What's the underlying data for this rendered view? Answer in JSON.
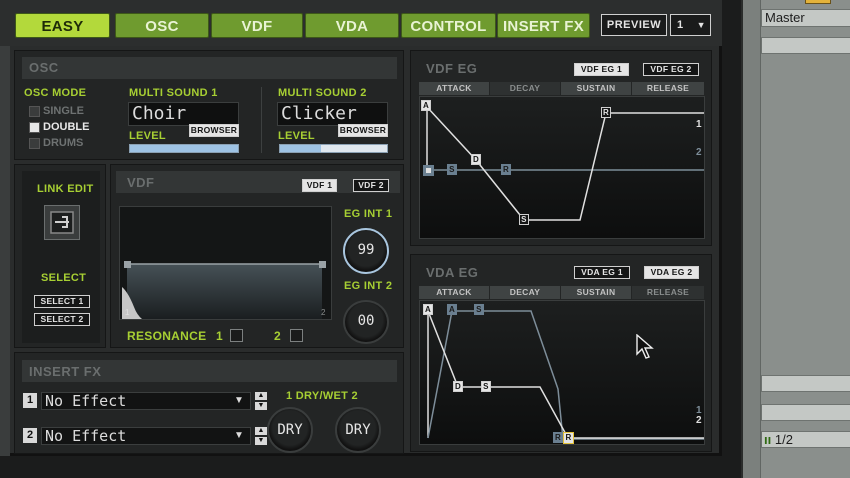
{
  "tabs": [
    {
      "label": "EASY",
      "active": true
    },
    {
      "label": "OSC",
      "active": false
    },
    {
      "label": "VDF",
      "active": false
    },
    {
      "label": "VDA",
      "active": false
    },
    {
      "label": "CONTROL",
      "active": false
    },
    {
      "label": "INSERT FX",
      "active": false
    }
  ],
  "preview": {
    "label": "PREVIEW",
    "program": "1"
  },
  "osc": {
    "title": "OSC",
    "mode_label": "OSC MODE",
    "modes": [
      {
        "label": "SINGLE",
        "on": false
      },
      {
        "label": "DOUBLE",
        "on": true
      },
      {
        "label": "DRUMS",
        "on": false
      }
    ],
    "sound1": {
      "label": "MULTI SOUND  1",
      "name": "Choir",
      "level_label": "LEVEL",
      "browser": "BROWSER",
      "level": 1.0
    },
    "sound2": {
      "label": "MULTI SOUND  2",
      "name": "Clicker",
      "level_label": "LEVEL",
      "browser": "BROWSER",
      "level": 0.38
    }
  },
  "link": {
    "edit_label": "LINK EDIT",
    "select_label": "SELECT",
    "select1": "SELECT 1",
    "select2": "SELECT 2"
  },
  "vdf": {
    "title": "VDF",
    "btn1": "VDF 1",
    "btn2": "VDF 2",
    "eg_int1_label": "EG INT 1",
    "eg_int1_value": "99",
    "eg_int2_label": "EG INT 2",
    "eg_int2_value": "00",
    "resonance_label": "RESONANCE",
    "res1": "1",
    "res2": "2",
    "graph_label1": "1",
    "graph_label2": "2"
  },
  "insert_fx": {
    "title": "INSERT FX",
    "slot1": {
      "num": "1",
      "value": "No Effect"
    },
    "slot2": {
      "num": "2",
      "value": "No Effect"
    },
    "drywet_label": "1 DRY/WET 2",
    "knob1": "DRY",
    "knob2": "DRY"
  },
  "vdf_eg": {
    "title": "VDF EG",
    "btn1": "VDF EG 1",
    "btn2": "VDF EG 2",
    "stages": [
      "ATTACK",
      "DECAY",
      "SUSTAIN",
      "RELEASE"
    ],
    "markers": [
      "A",
      "D",
      "S",
      "R",
      "S",
      "R"
    ],
    "side1": "1",
    "side2": "2"
  },
  "vda_eg": {
    "title": "VDA EG",
    "btn1": "VDA EG 1",
    "btn2": "VDA EG 2",
    "stages": [
      "ATTACK",
      "DECAY",
      "SUSTAIN",
      "RELEASE"
    ],
    "markers": [
      "A",
      "A",
      "S",
      "D",
      "S",
      "R",
      "R"
    ],
    "side1": "1",
    "side2": "2"
  },
  "host": {
    "track_name": "Master",
    "counter": "1/2"
  },
  "colors": {
    "accent_green": "#a7cf33",
    "tab_green": "#6f9b2f",
    "tab_active": "#b3d93b"
  }
}
